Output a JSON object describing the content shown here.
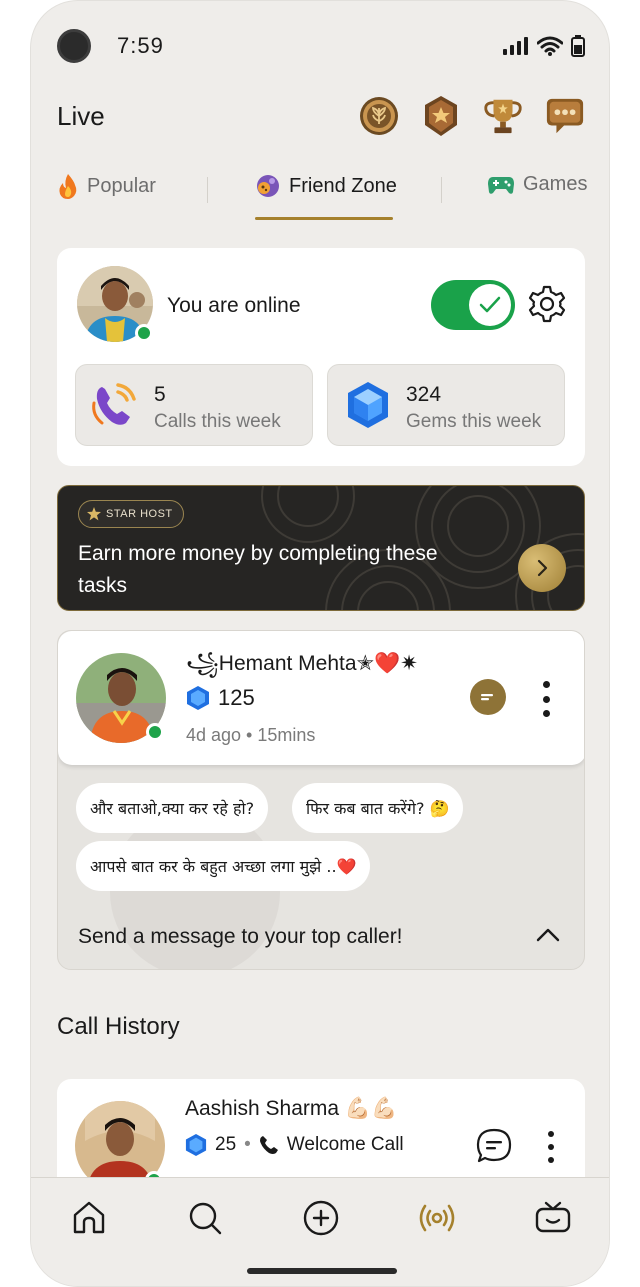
{
  "status_bar": {
    "time": "7:59"
  },
  "header": {
    "title": "Live"
  },
  "tabs": [
    {
      "label": "Popular",
      "icon": "fire-icon"
    },
    {
      "label": "Friend Zone",
      "icon": "cookie-icon",
      "active": true
    },
    {
      "label": "Games",
      "icon": "gamepad-icon"
    }
  ],
  "online_card": {
    "status_text": "You are online",
    "toggle_on": true,
    "calls": {
      "value": "5",
      "label": "Calls this week"
    },
    "gems": {
      "value": "324",
      "label": "Gems this week"
    }
  },
  "banner": {
    "pill": "STAR HOST",
    "text": "Earn more money by completing these tasks"
  },
  "top_caller": {
    "name": "꧁Hemant Mehta✭❤️✷",
    "gems": "125",
    "meta": "4d ago • 15mins",
    "chips": [
      "और बताओ,क्या कर रहे हो?",
      "फिर कब बात करेंगे? 🤔",
      "आपसे बात कर के बहुत अच्छा लगा मुझे ..❤️"
    ],
    "prompt": "Send a message to your top caller!"
  },
  "call_history": {
    "title": "Call History",
    "items": [
      {
        "name": "Aashish Sharma 💪🏻💪🏻",
        "gems": "25",
        "separator": "•",
        "call_type": "Welcome Call"
      }
    ]
  },
  "bottom_nav": [
    "home-icon",
    "search-icon",
    "add-icon",
    "live-icon",
    "tv-icon"
  ],
  "colors": {
    "accent_gold": "#a5812d",
    "online_green": "#1aa24a",
    "background": "#efedea"
  }
}
